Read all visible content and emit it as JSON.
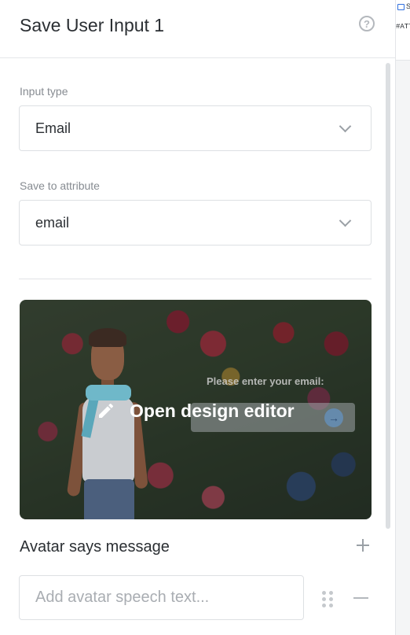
{
  "header": {
    "title": "Save User Input 1",
    "help_icon": "help-circle-icon"
  },
  "input_type": {
    "label": "Input type",
    "value": "Email"
  },
  "save_to_attribute": {
    "label": "Save to attribute",
    "value": "email"
  },
  "preview": {
    "prompt_text": "Please enter your email:",
    "edit_label": "Open design editor",
    "edit_icon": "pencil-icon"
  },
  "avatar_message": {
    "title": "Avatar says message",
    "placeholder": "Add avatar speech text..."
  },
  "right_strip": {
    "top_text": "S",
    "attr_text": "#ATT"
  }
}
